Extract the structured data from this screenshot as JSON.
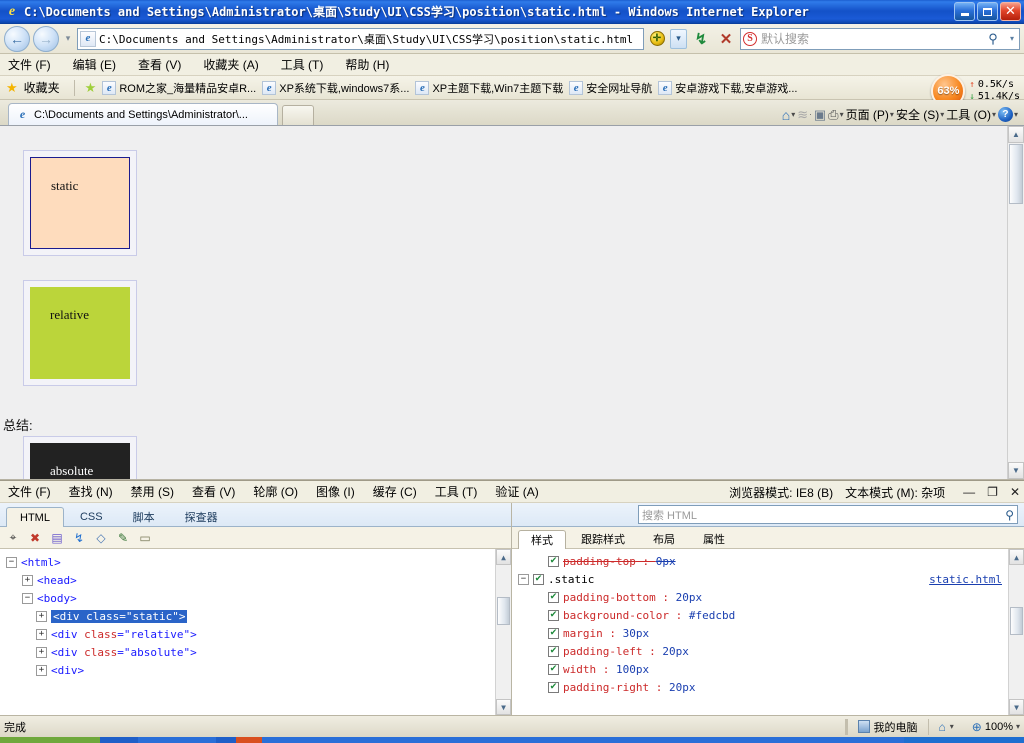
{
  "window": {
    "title": "C:\\Documents and Settings\\Administrator\\桌面\\Study\\UI\\CSS学习\\position\\static.html - Windows Internet Explorer",
    "minimize_label": "Minimize",
    "maximize_label": "Restore",
    "close_label": "Close"
  },
  "nav": {
    "back_label": "←",
    "forward_label": "→",
    "history_caret": "▾",
    "address_value": "C:\\Documents and Settings\\Administrator\\桌面\\Study\\UI\\CSS学习\\position\\static.html",
    "compat_label": "✛",
    "address_dropdown": "▾",
    "refresh_label": "↯",
    "stop_label": "✕",
    "search_placeholder": "默认搜索",
    "search_brand": "S",
    "search_go": "⚲",
    "search_caret": "▾"
  },
  "menu": {
    "items": [
      {
        "label": "文件 (F)"
      },
      {
        "label": "编辑 (E)"
      },
      {
        "label": "查看 (V)"
      },
      {
        "label": "收藏夹 (A)"
      },
      {
        "label": "工具 (T)"
      },
      {
        "label": "帮助 (H)"
      }
    ]
  },
  "favorites": {
    "star_glyph": "★",
    "bar_label": "收藏夹",
    "add_glyph": "★",
    "items": [
      {
        "label": "ROM之家_海量精品安卓R..."
      },
      {
        "label": "XP系统下载,windows7系..."
      },
      {
        "label": "XP主题下载,Win7主题下载"
      },
      {
        "label": "安全网址导航"
      },
      {
        "label": "安卓游戏下载,安卓游戏..."
      }
    ]
  },
  "speed_meter": {
    "percent": "63%",
    "upload": "0.5K/s",
    "download": "51.4K/s",
    "up_arrow": "↑",
    "down_arrow": "↓"
  },
  "tabs": {
    "items": [
      {
        "label": "C:\\Documents and Settings\\Administrator\\..."
      }
    ],
    "new_tab_label": ""
  },
  "command_bar": {
    "home_icon": "home-icon",
    "feeds_icon": "rss-icon",
    "mail_icon": "mail-icon",
    "print_icon": "printer-icon",
    "page_label": "页面 (P)",
    "safety_label": "安全 (S)",
    "tools_label": "工具 (O)",
    "help_label": "?",
    "caret": "▾"
  },
  "page_content": {
    "boxes": [
      {
        "label": "static",
        "color": "#fedcbd"
      },
      {
        "label": "relative",
        "color": "#bbd53a"
      },
      {
        "label": "absolute",
        "color": "#222222"
      }
    ],
    "summary_label": "总结:"
  },
  "devtools": {
    "menu_items": [
      {
        "label": "文件 (F)"
      },
      {
        "label": "查找 (N)"
      },
      {
        "label": "禁用 (S)"
      },
      {
        "label": "查看 (V)"
      },
      {
        "label": "轮廓 (O)"
      },
      {
        "label": "图像 (I)"
      },
      {
        "label": "缓存 (C)"
      },
      {
        "label": "工具 (T)"
      },
      {
        "label": "验证 (A)"
      }
    ],
    "browser_mode": "浏览器模式: IE8 (B)",
    "text_mode": "文本模式 (M):  杂项",
    "win_min": "—",
    "win_restore": "❐",
    "win_close": "✕",
    "tabs": [
      {
        "label": "HTML",
        "active": true
      },
      {
        "label": "CSS",
        "active": false
      },
      {
        "label": "脚本",
        "active": false
      },
      {
        "label": "探查器",
        "active": false
      }
    ],
    "toolbar_icons": [
      {
        "name": "select-element-icon",
        "glyph": "⌖"
      },
      {
        "name": "clear-browser-cache-icon",
        "glyph": "✖"
      },
      {
        "name": "save-icon",
        "glyph": "▤"
      },
      {
        "name": "refresh-icon",
        "glyph": "↯"
      },
      {
        "name": "view-source-icon",
        "glyph": "◇"
      },
      {
        "name": "edit-icon",
        "glyph": "✎"
      },
      {
        "name": "outline-icon",
        "glyph": "▭"
      }
    ],
    "search_placeholder": "搜索 HTML",
    "search_icon": "magnifier-icon",
    "sub_tabs": [
      {
        "label": "样式",
        "active": true
      },
      {
        "label": "跟踪样式",
        "active": false
      },
      {
        "label": "布局",
        "active": false
      },
      {
        "label": "属性",
        "active": false
      }
    ],
    "dom_tree": [
      {
        "indent": 0,
        "expander": "−",
        "text": "<html>",
        "selected": false,
        "tag": "<html>"
      },
      {
        "indent": 1,
        "expander": "+",
        "text": "<head>",
        "selected": false,
        "tag": "<head>"
      },
      {
        "indent": 1,
        "expander": "−",
        "text": "<body>",
        "selected": false,
        "tag": "<body>"
      },
      {
        "indent": 2,
        "expander": "+",
        "tag": "<div ",
        "attr": "class",
        "value": "=\"static\">",
        "selected": true
      },
      {
        "indent": 2,
        "expander": "+",
        "tag": "<div ",
        "attr": "class",
        "value": "=\"relative\">",
        "selected": false
      },
      {
        "indent": 2,
        "expander": "+",
        "tag": "<div ",
        "attr": "class",
        "value": "=\"absolute\">",
        "selected": false
      },
      {
        "indent": 2,
        "expander": "+",
        "tag": "<div>",
        "attr": "",
        "value": "",
        "selected": false
      }
    ],
    "css_rules": [
      {
        "kind": "decl",
        "indent": 3,
        "prop": "padding-top",
        "value": "0px",
        "struck": true
      },
      {
        "kind": "selector",
        "indent": 0,
        "expander": "−",
        "name": ".static",
        "source": "static.html"
      },
      {
        "kind": "decl",
        "indent": 3,
        "prop": "padding-bottom",
        "value": "20px",
        "struck": false
      },
      {
        "kind": "decl",
        "indent": 3,
        "prop": "background-color",
        "value": "#fedcbd",
        "struck": false
      },
      {
        "kind": "decl",
        "indent": 3,
        "prop": "margin",
        "value": "30px",
        "struck": false
      },
      {
        "kind": "decl",
        "indent": 3,
        "prop": "padding-left",
        "value": "20px",
        "struck": false
      },
      {
        "kind": "decl",
        "indent": 3,
        "prop": "width",
        "value": "100px",
        "struck": false
      },
      {
        "kind": "decl",
        "indent": 3,
        "prop": "padding-right",
        "value": "20px",
        "struck": false
      }
    ]
  },
  "statusbar": {
    "status_text": "完成",
    "zone_label": "我的电脑",
    "zoom_label": "100%",
    "zoom_caret": "▾",
    "zone_caret": "▾"
  }
}
